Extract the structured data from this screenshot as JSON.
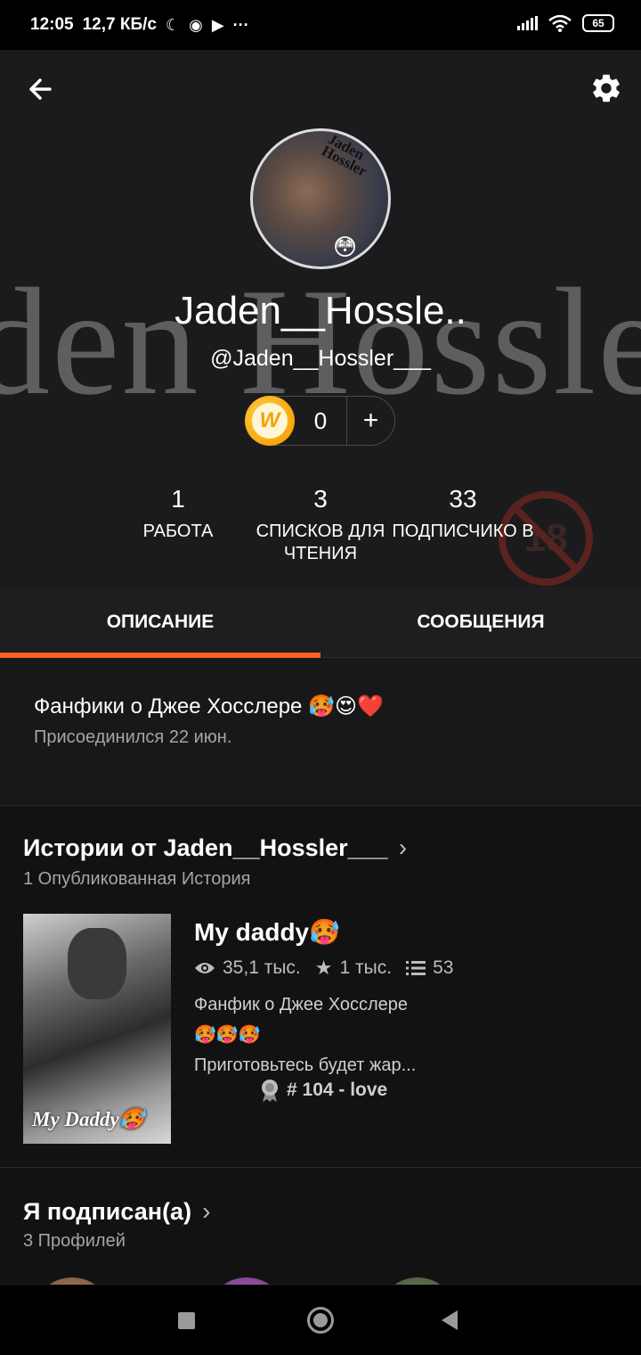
{
  "status_bar": {
    "time": "12:05",
    "speed": "12,7 КБ/с",
    "icons": [
      "moon-icon",
      "notification-icon",
      "app-icon",
      "more-icon"
    ],
    "battery": "65"
  },
  "header": {
    "background_name": "den Hossler",
    "display_name": "Jaden__Hossle..",
    "username": "@Jaden__Hossler___",
    "avatar_stamp": "Jaden\nHossler",
    "coins": {
      "count": "0",
      "plus": "+"
    },
    "stats": [
      {
        "value": "1",
        "label": "РАБОТА"
      },
      {
        "value": "3",
        "label": "СПИСКОВ ДЛЯ ЧТЕНИЯ"
      },
      {
        "value": "33",
        "label": "ПОДПИСЧИКО В"
      }
    ],
    "badge": "18"
  },
  "tabs": [
    {
      "label": "ОПИСАНИЕ",
      "active": true
    },
    {
      "label": "СООБЩЕНИЯ",
      "active": false
    }
  ],
  "description": {
    "text": "Фанфики о Джее Хосслере 🥵😍❤️",
    "joined": "Присоединился 22 июн."
  },
  "stories": {
    "title": "Истории от Jaden__Hossler___",
    "subtitle": "1 Опубликованная История",
    "item": {
      "cover_text": "My Daddy🥵",
      "title": "My daddy🥵",
      "views": "35,1 тыс.",
      "votes": "1 тыс.",
      "parts": "53",
      "desc_line1": "Фанфик о Джее Хосслере",
      "desc_line2": "🥵🥵🥵",
      "desc_line3": "Приготовьтесь будет жар...",
      "rank": "# 104 - love"
    }
  },
  "following": {
    "title": "Я подписан(а)",
    "subtitle": "3 Профилей"
  },
  "colors": {
    "accent": "#ff6122",
    "background": "#121212",
    "header_bg": "#1b1b1d",
    "muted_text": "#a5a5a5"
  }
}
